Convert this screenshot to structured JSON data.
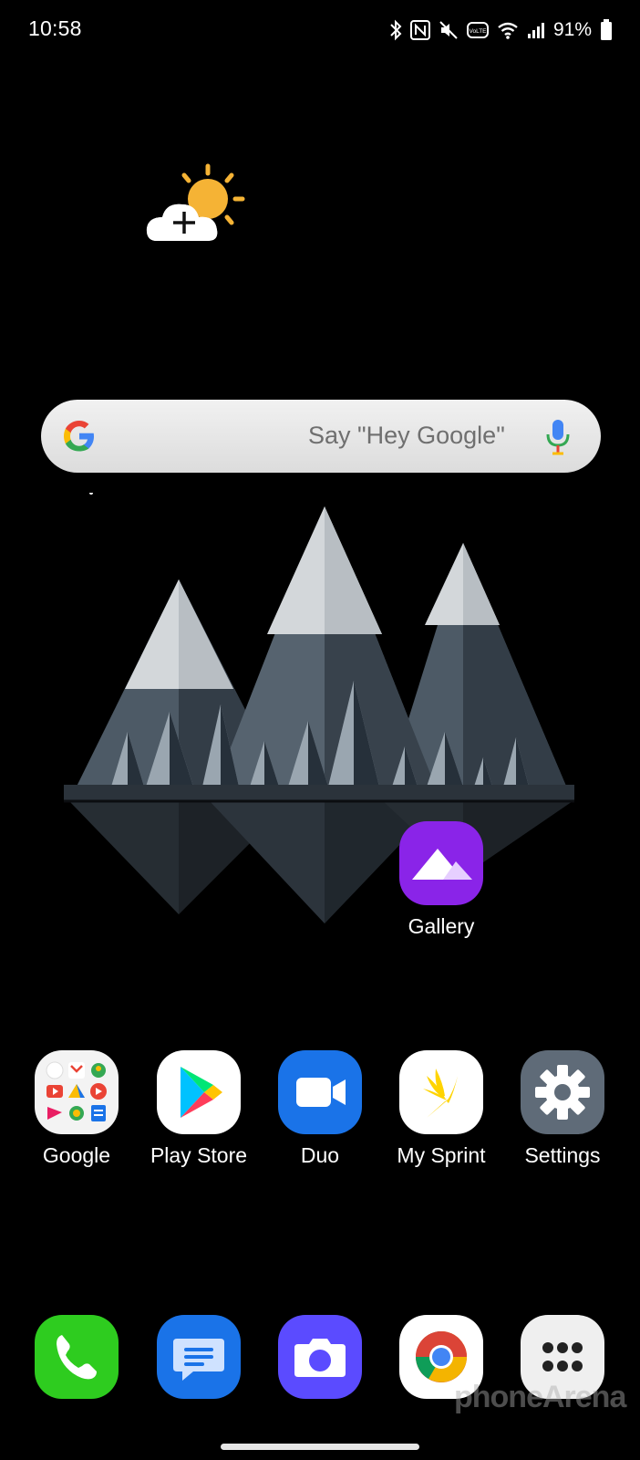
{
  "status_bar": {
    "time": "10:58",
    "battery_percent": "91%",
    "icons": [
      "bluetooth-icon",
      "nfc-icon",
      "mute-icon",
      "volte-icon",
      "wifi-icon",
      "signal-icon",
      "battery-icon"
    ],
    "volte_label": "VoLTE"
  },
  "weather_widget": {
    "icon": "weather-add-icon"
  },
  "search": {
    "hint": "Say \"Hey Google\""
  },
  "home_apps": [
    {
      "label": "Gallery"
    }
  ],
  "row_apps": [
    {
      "label": "Google"
    },
    {
      "label": "Play Store"
    },
    {
      "label": "Duo"
    },
    {
      "label": "My Sprint"
    },
    {
      "label": "Settings"
    }
  ],
  "dock": [
    {
      "icon": "phone-icon"
    },
    {
      "icon": "messages-icon"
    },
    {
      "icon": "camera-icon"
    },
    {
      "icon": "chrome-icon"
    },
    {
      "icon": "app-drawer-icon"
    }
  ],
  "watermark": "phoneArena",
  "colors": {
    "background": "#000000",
    "gallery": "#8a24e8",
    "duo": "#1a73e8",
    "phone": "#2ecc1f",
    "messages": "#1a73e8",
    "camera": "#5b4bff",
    "settings": "#5f6b78"
  }
}
